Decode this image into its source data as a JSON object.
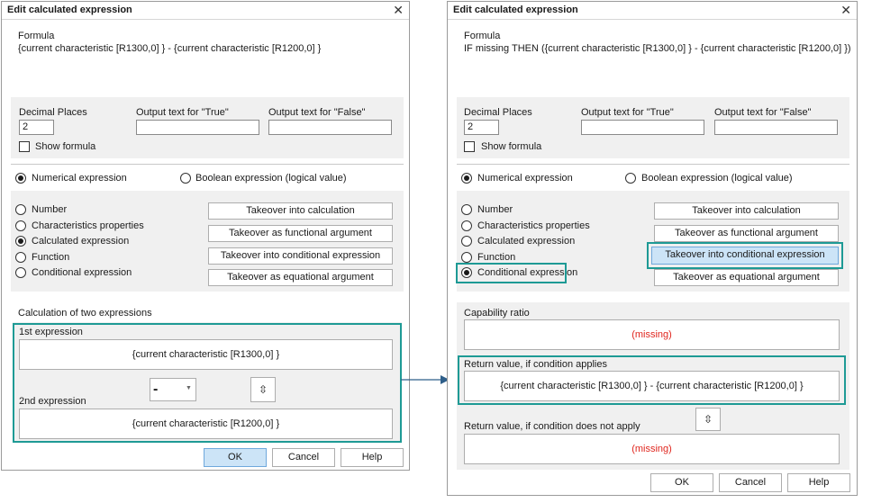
{
  "left": {
    "title": "Edit calculated expression",
    "formula_label": "Formula",
    "formula_text": "{current characteristic [R1300,0] } - {current characteristic [R1200,0] }",
    "decimal_label": "Decimal Places",
    "decimal_value": "2",
    "true_label": "Output text for \"True\"",
    "false_label": "Output text for \"False\"",
    "show_formula": "Show formula",
    "numerical": "Numerical expression",
    "boolean": "Boolean expression (logical value)",
    "radios": [
      "Number",
      "Characteristics properties",
      "Calculated expression",
      "Function",
      "Conditional expression"
    ],
    "buttons": [
      "Takeover into calculation",
      "Takeover as functional argument",
      "Takeover into conditional expression",
      "Takeover as equational argument"
    ],
    "calc_title": "Calculation of two expressions",
    "first_label": "1st expression",
    "first_value": "{current characteristic [R1300,0] }",
    "operator": "-",
    "second_label": "2nd expression",
    "second_value": "{current characteristic [R1200,0] }",
    "ok": "OK",
    "cancel": "Cancel",
    "help": "Help"
  },
  "right": {
    "title": "Edit calculated expression",
    "formula_label": "Formula",
    "formula_text": "IF missing THEN ({current characteristic [R1300,0] } - {current characteristic [R1200,0] }) ELSE missi",
    "decimal_label": "Decimal Places",
    "decimal_value": "2",
    "true_label": "Output text for \"True\"",
    "false_label": "Output text for \"False\"",
    "show_formula": "Show formula",
    "numerical": "Numerical expression",
    "boolean": "Boolean expression (logical value)",
    "radios": [
      "Number",
      "Characteristics properties",
      "Calculated expression",
      "Function",
      "Conditional expression"
    ],
    "buttons": [
      "Takeover into calculation",
      "Takeover as functional argument",
      "Takeover into conditional expression",
      "Takeover as equational argument"
    ],
    "capability_label": "Capability ratio",
    "capability_value": "(missing)",
    "applies_label": "Return value, if condition applies",
    "applies_value": "{current characteristic [R1300,0] } - {current characteristic [R1200,0] }",
    "not_applies_label": "Return value, if condition does not apply",
    "not_applies_value": "(missing)",
    "ok": "OK",
    "cancel": "Cancel",
    "help": "Help"
  },
  "colors": {
    "highlight": "#1e9a95",
    "missing": "#e0271f",
    "panel": "#f0f0f0",
    "selected_button": "#cce4f7"
  },
  "icons": {
    "close": "close-icon",
    "swap": "swap-vertical-icon",
    "dropdown": "chevron-down-icon",
    "arrow": "arrow-right-icon"
  }
}
